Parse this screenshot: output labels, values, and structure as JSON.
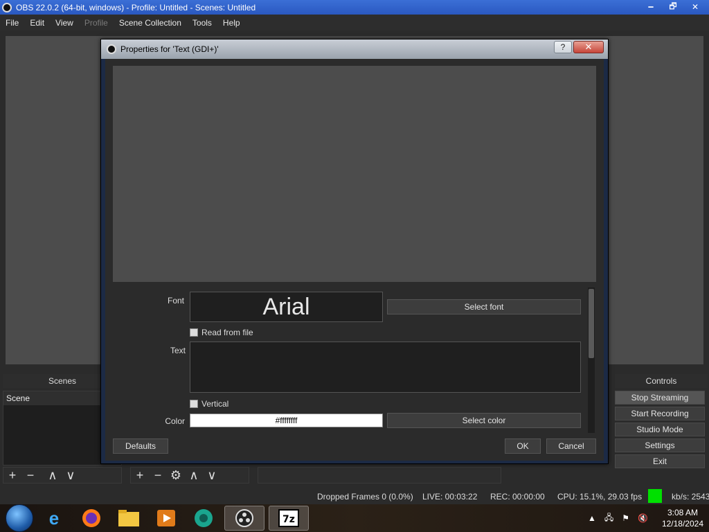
{
  "window": {
    "title": "OBS 22.0.2 (64-bit, windows) - Profile: Untitled - Scenes: Untitled",
    "minimize": "🗕",
    "maximize": "🗗",
    "close": "✕"
  },
  "menu": [
    "File",
    "Edit",
    "View",
    "Profile",
    "Scene Collection",
    "Tools",
    "Help"
  ],
  "docks": {
    "scenes_header": "Scenes",
    "controls_header": "Controls",
    "scene_items": [
      "Scene"
    ]
  },
  "controls": [
    "Stop Streaming",
    "Start Recording",
    "Studio Mode",
    "Settings",
    "Exit"
  ],
  "status": {
    "dropped_frames": "Dropped Frames 0 (0.0%)",
    "live": "LIVE: 00:03:22",
    "rec": "REC: 00:00:00",
    "cpu": "CPU: 15.1%, 29.03 fps",
    "kbps": "kb/s: 2543"
  },
  "dialog": {
    "title": "Properties for 'Text (GDI+)'",
    "help": "?",
    "close": "✕",
    "font_label": "Font",
    "font_name": "Arial",
    "select_font": "Select font",
    "read_from_file": "Read from file",
    "text_label": "Text",
    "vertical": "Vertical",
    "color_label": "Color",
    "color_value": "#ffffffff",
    "select_color": "Select color",
    "defaults": "Defaults",
    "ok": "OK",
    "cancel": "Cancel"
  },
  "taskbar": {
    "time": "3:08 AM",
    "date": "12/18/2024"
  },
  "icons": {
    "add": "+",
    "remove": "−",
    "up": "∧",
    "down": "∨",
    "gear": "⚙"
  },
  "colors": {
    "title_blue": "#2a58c0",
    "stream_indicator": "#00e000"
  }
}
